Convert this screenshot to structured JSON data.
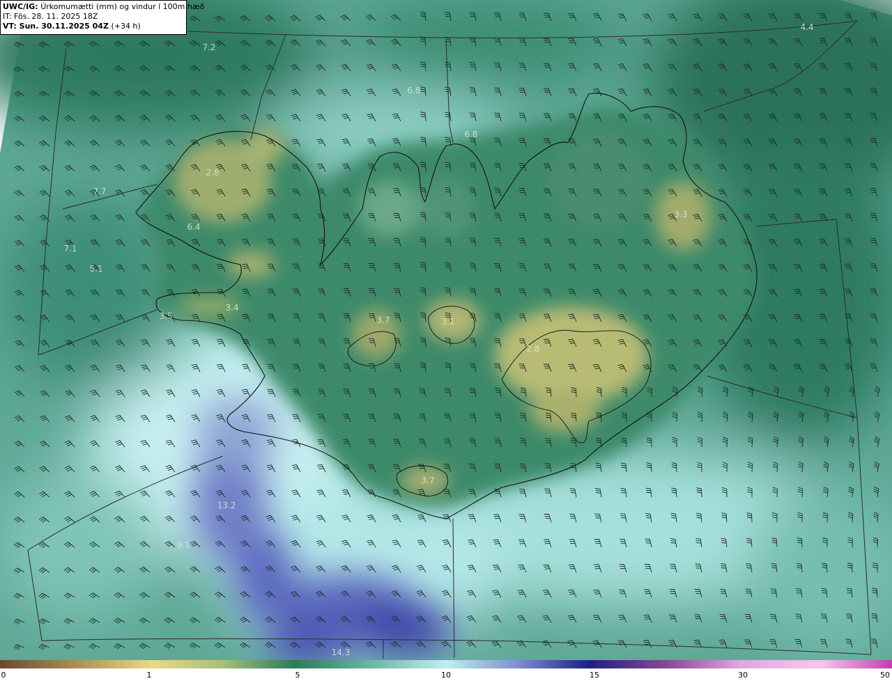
{
  "header": {
    "model_label": "UWC/IG:",
    "description": "Úrkomumætti (mm) og vindur í 100m hæð",
    "init_time": "IT: Fös. 28. 11. 2025 18Z",
    "valid_time_label": "VT: Sun. 30.11.2025 04Z",
    "valid_offset": "(+34 h)"
  },
  "values": [
    {
      "text": "4.4",
      "cls": "light"
    },
    {
      "text": "7.2",
      "cls": "light"
    },
    {
      "text": "6.8",
      "cls": "light"
    },
    {
      "text": "6.8",
      "cls": "light"
    },
    {
      "text": "2.8",
      "cls": "light"
    },
    {
      "text": "7.7",
      "cls": "light"
    },
    {
      "text": "6.4",
      "cls": "light"
    },
    {
      "text": "7.1",
      "cls": "light"
    },
    {
      "text": "5.1",
      "cls": "light"
    },
    {
      "text": "3.3",
      "cls": "light"
    },
    {
      "text": "3.4",
      "cls": "light"
    },
    {
      "text": "3.5",
      "cls": "light"
    },
    {
      "text": "3.7",
      "cls": "light"
    },
    {
      "text": "3.1",
      "cls": "light"
    },
    {
      "text": "2.8",
      "cls": "light"
    },
    {
      "text": "3.7",
      "cls": "light"
    },
    {
      "text": "13.2",
      "cls": "light"
    },
    {
      "text": "9.1",
      "cls": "light"
    },
    {
      "text": "14.3",
      "cls": "light"
    }
  ],
  "colorbar": {
    "labels": [
      "0",
      "1",
      "5",
      "10",
      "15",
      "30",
      "50"
    ]
  },
  "colors": {
    "ocean_dark": "#2a6e58",
    "ocean_mid": "#5fa898",
    "ocean_light": "#a7e0dc",
    "precip_blue": "#5a66b8",
    "land_yellow": "#b8b873",
    "barb": "#1e2a26"
  }
}
